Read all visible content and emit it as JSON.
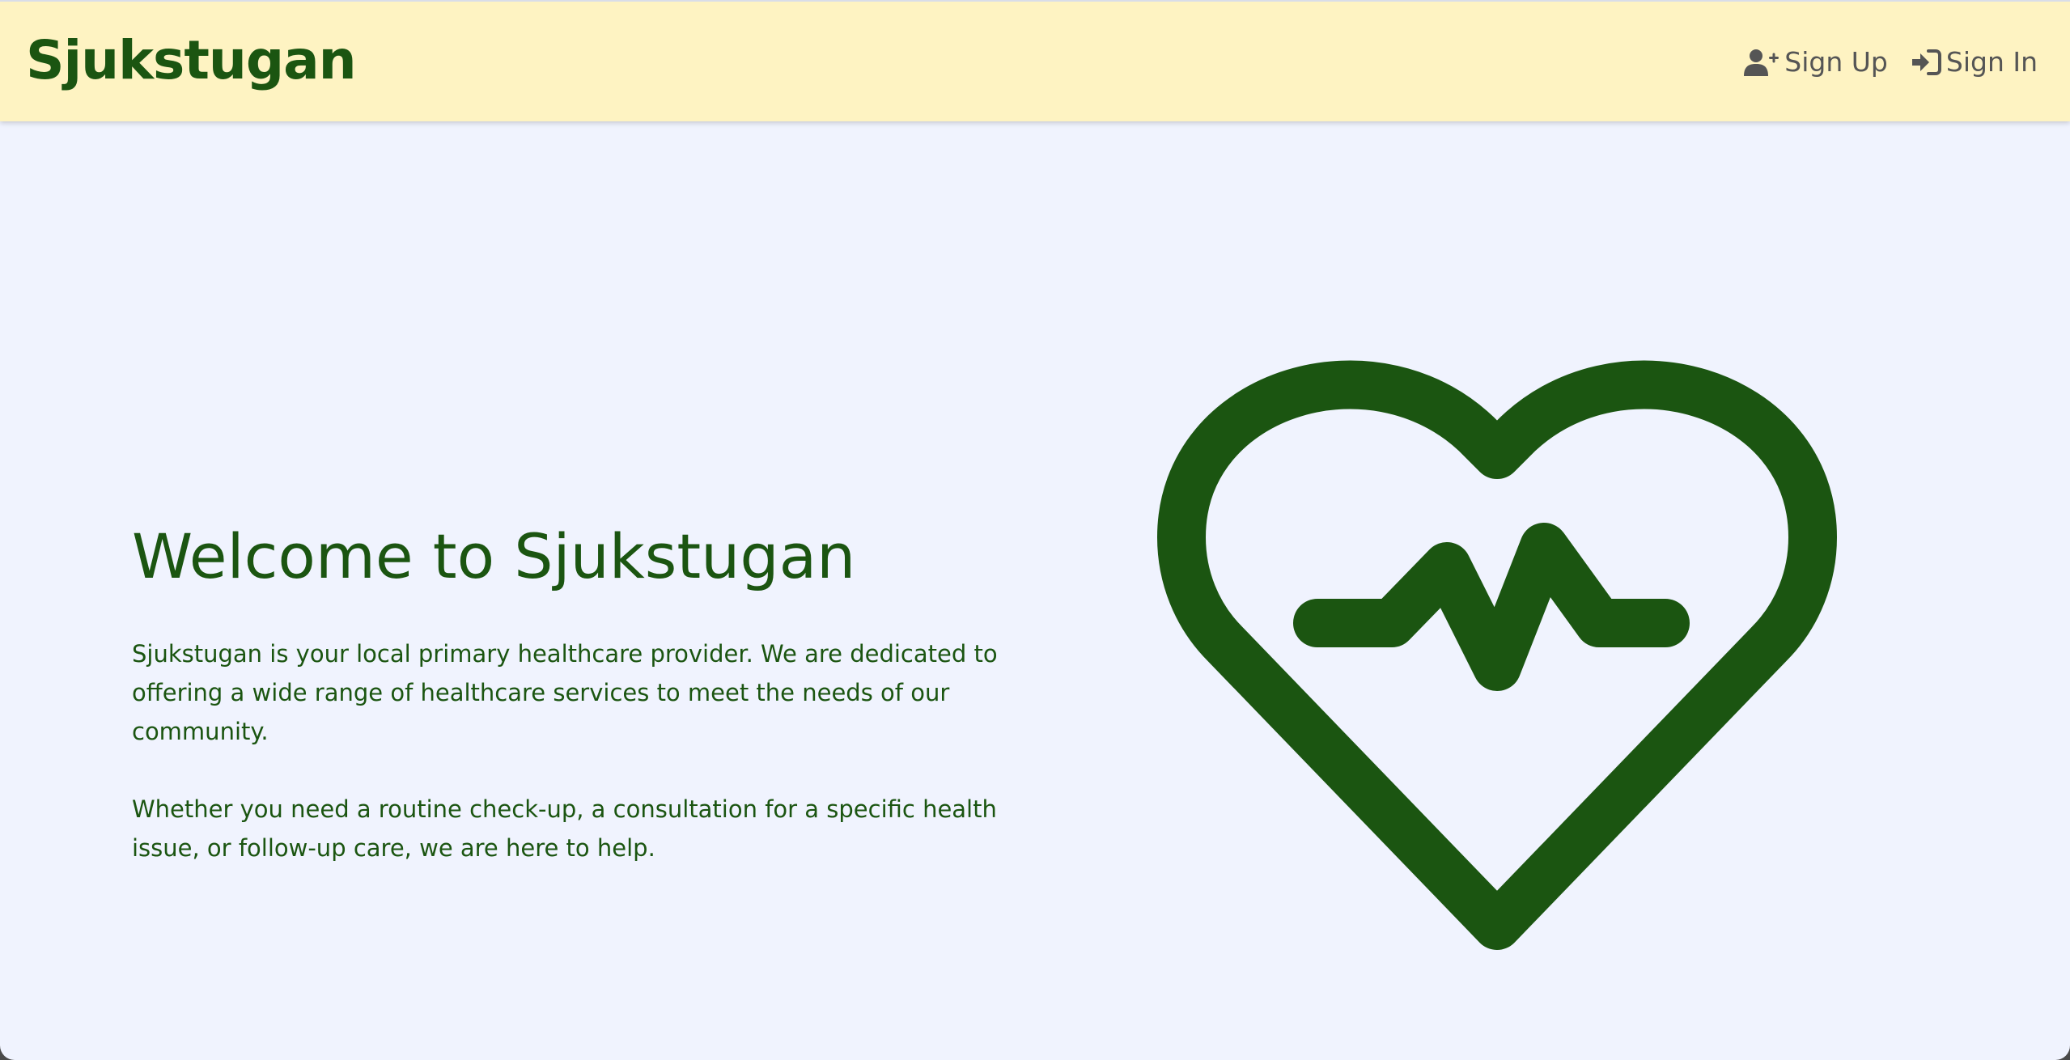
{
  "navbar": {
    "brand": "Sjukstugan",
    "signup_label": "Sign Up",
    "signin_label": "Sign In",
    "signup_icon": "user-plus-icon",
    "signin_icon": "sign-in-icon"
  },
  "hero": {
    "title": "Welcome to Sjukstugan",
    "paragraphs": [
      "Sjukstugan is your local primary healthcare provider. We are dedicated to offering a wide range of healthcare services to meet the needs of our community.",
      "Whether you need a routine check-up, a consultation for a specific health issue, or follow-up care, we are here to help."
    ],
    "illustration_icon": "heart-pulse-icon"
  },
  "colors": {
    "brand_green": "#1b5511",
    "navbar_bg": "#fef3c2",
    "page_bg": "#f0f3fe",
    "nav_text": "#555555"
  }
}
